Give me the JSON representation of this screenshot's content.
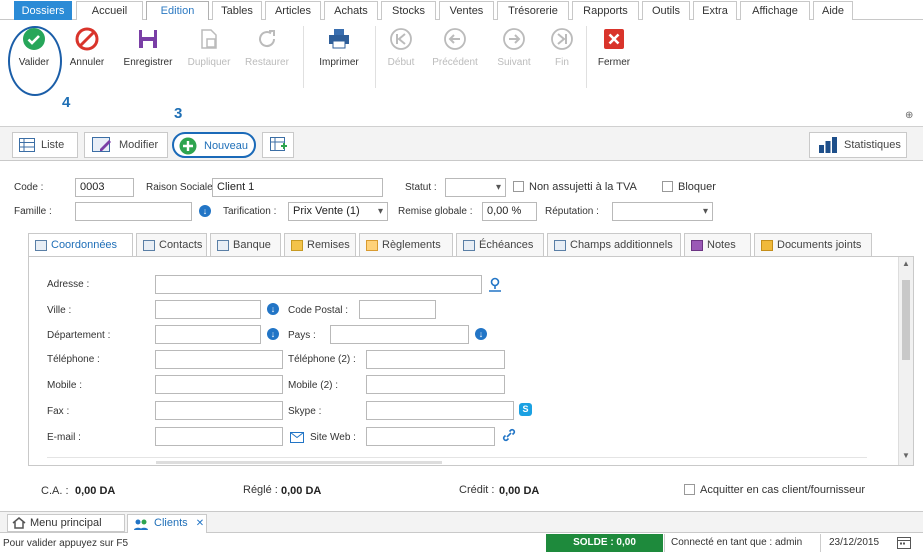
{
  "menu": {
    "tabs": [
      "Dossiers",
      "Accueil",
      "Edition",
      "Tables",
      "Articles",
      "Achats",
      "Stocks",
      "Ventes",
      "Trésorerie",
      "Rapports",
      "Outils",
      "Extra",
      "Affichage",
      "Aide"
    ]
  },
  "ribbon": {
    "buttons": [
      "Valider",
      "Annuler",
      "Enregistrer",
      "Dupliquer",
      "Restaurer",
      "Imprimer",
      "Début",
      "Précédent",
      "Suivant",
      "Fin",
      "Fermer"
    ],
    "annotation_4": "4",
    "annotation_3": "3",
    "collapse_glyph": "⊕"
  },
  "subbar": {
    "liste": "Liste",
    "modifier": "Modifier",
    "nouveau": "Nouveau",
    "statistiques": "Statistiques"
  },
  "form": {
    "code_label": "Code :",
    "code_value": "0003",
    "raison_label": "Raison Sociale :",
    "raison_value": "Client 1",
    "statut_label": "Statut :",
    "statut_value": "",
    "tva_label": "Non assujetti à la TVA",
    "bloquer_label": "Bloquer",
    "famille_label": "Famille :",
    "famille_value": "",
    "tarif_label": "Tarification :",
    "tarif_value": "Prix Vente (1)",
    "remise_label": "Remise globale :",
    "remise_value": "0,00 %",
    "reputation_label": "Réputation :",
    "reputation_value": ""
  },
  "inner_tabs": [
    "Coordonnées",
    "Contacts",
    "Banque",
    "Remises",
    "Règlements",
    "Échéances",
    "Champs additionnels",
    "Notes",
    "Documents joints"
  ],
  "coordonnees": {
    "adresse": "Adresse :",
    "ville": "Ville :",
    "code_postal": "Code Postal :",
    "departement": "Département :",
    "pays": "Pays :",
    "telephone": "Téléphone :",
    "telephone2": "Téléphone (2) :",
    "mobile": "Mobile :",
    "mobile2": "Mobile (2) :",
    "fax": "Fax :",
    "skype": "Skype :",
    "email": "E-mail :",
    "site_web": "Site Web :"
  },
  "totals": {
    "ca_label": "C.A. :",
    "ca_value": "0,00 DA",
    "regle_label": "Réglé :",
    "regle_value": "0,00 DA",
    "credit_label": "Crédit :",
    "credit_value": "0,00 DA",
    "acquitter_label": "Acquitter en cas client/fournisseur"
  },
  "bottom_tabs": {
    "menu_principal": "Menu principal",
    "clients": "Clients",
    "close_glyph": "✕"
  },
  "status": {
    "hint": "Pour valider appuyez sur F5",
    "solde": "SOLDE : 0,00",
    "user": "Connecté en tant que : admin",
    "date": "23/12/2015"
  },
  "colors": {
    "accent": "#2b8bd6",
    "valider": "#27a65a",
    "annuler": "#d9342b",
    "solde_bg": "#1e8a3c"
  }
}
